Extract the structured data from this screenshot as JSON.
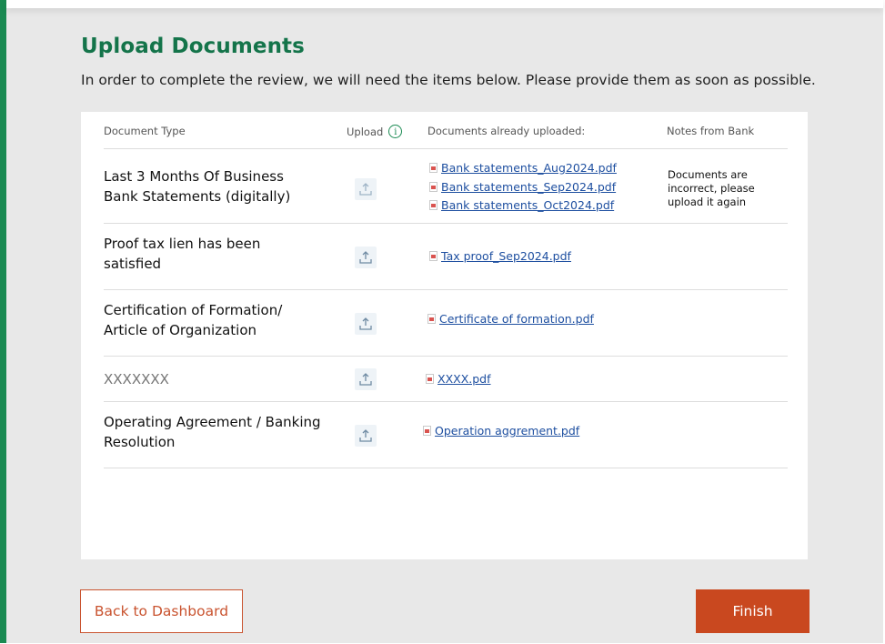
{
  "page": {
    "title": "Upload Documents",
    "intro": "In order to complete the review, we will need the items below. Please provide them as soon as possible."
  },
  "table": {
    "headers": {
      "document_type": "Document Type",
      "upload": "Upload",
      "uploaded": "Documents already uploaded:",
      "notes": "Notes from Bank"
    },
    "info_icon_glyph": "i",
    "rows": [
      {
        "doc_type": "Last 3 Months Of Business Bank Statements (digitally)",
        "files": [
          "Bank statements_Aug2024.pdf",
          "Bank statements_Sep2024.pdf",
          "Bank statements_Oct2024.pdf"
        ],
        "notes": "Documents are incorrect, please upload it again"
      },
      {
        "doc_type": "Proof tax lien has been satisfied",
        "files": [
          "Tax proof_Sep2024.pdf"
        ],
        "notes": ""
      },
      {
        "doc_type": "Certification of Formation/ Article of Organization",
        "files": [
          "Certificate of formation.pdf"
        ],
        "notes": ""
      },
      {
        "doc_type": "XXXXXXX",
        "files": [
          "XXXX.pdf"
        ],
        "notes": ""
      },
      {
        "doc_type": "Operating Agreement / Banking Resolution",
        "files": [
          "Operation aggrement.pdf"
        ],
        "notes": ""
      }
    ]
  },
  "actions": {
    "back_label": "Back to Dashboard",
    "finish_label": "Finish"
  },
  "colors": {
    "brand_green": "#14744a",
    "accent_orange": "#c9481f",
    "link_blue": "#1e4fa0"
  }
}
